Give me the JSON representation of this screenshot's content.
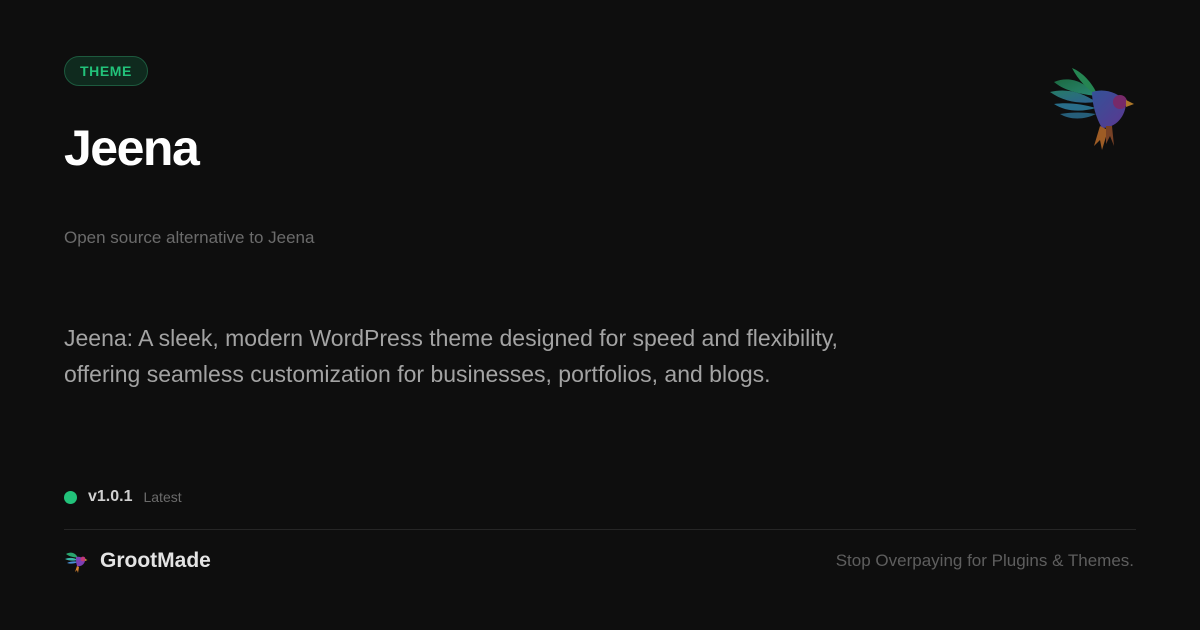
{
  "badge": {
    "label": "THEME"
  },
  "product": {
    "name": "Jeena",
    "subtitle": "Open source alternative  to Jeena",
    "description": "Jeena: A sleek, modern WordPress  theme designed for speed and flexibility,  offering  seamless customization  for businesses, portfolios,  and blogs."
  },
  "release": {
    "version": "v1.0.1",
    "status": "Latest"
  },
  "footer": {
    "brand_name": "GrootMade",
    "tagline": "Stop Overpaying  for Plugins & Themes."
  },
  "icons": {
    "bird": "bird-logo-icon",
    "brand": "grootmade-logo-icon",
    "status": "status-dot-icon"
  },
  "colors": {
    "background": "#0e0e0e",
    "accent": "#22c27a",
    "badge_bg": "#0f2a1e",
    "text_primary": "#ffffff",
    "text_muted": "#6b6b6b"
  }
}
